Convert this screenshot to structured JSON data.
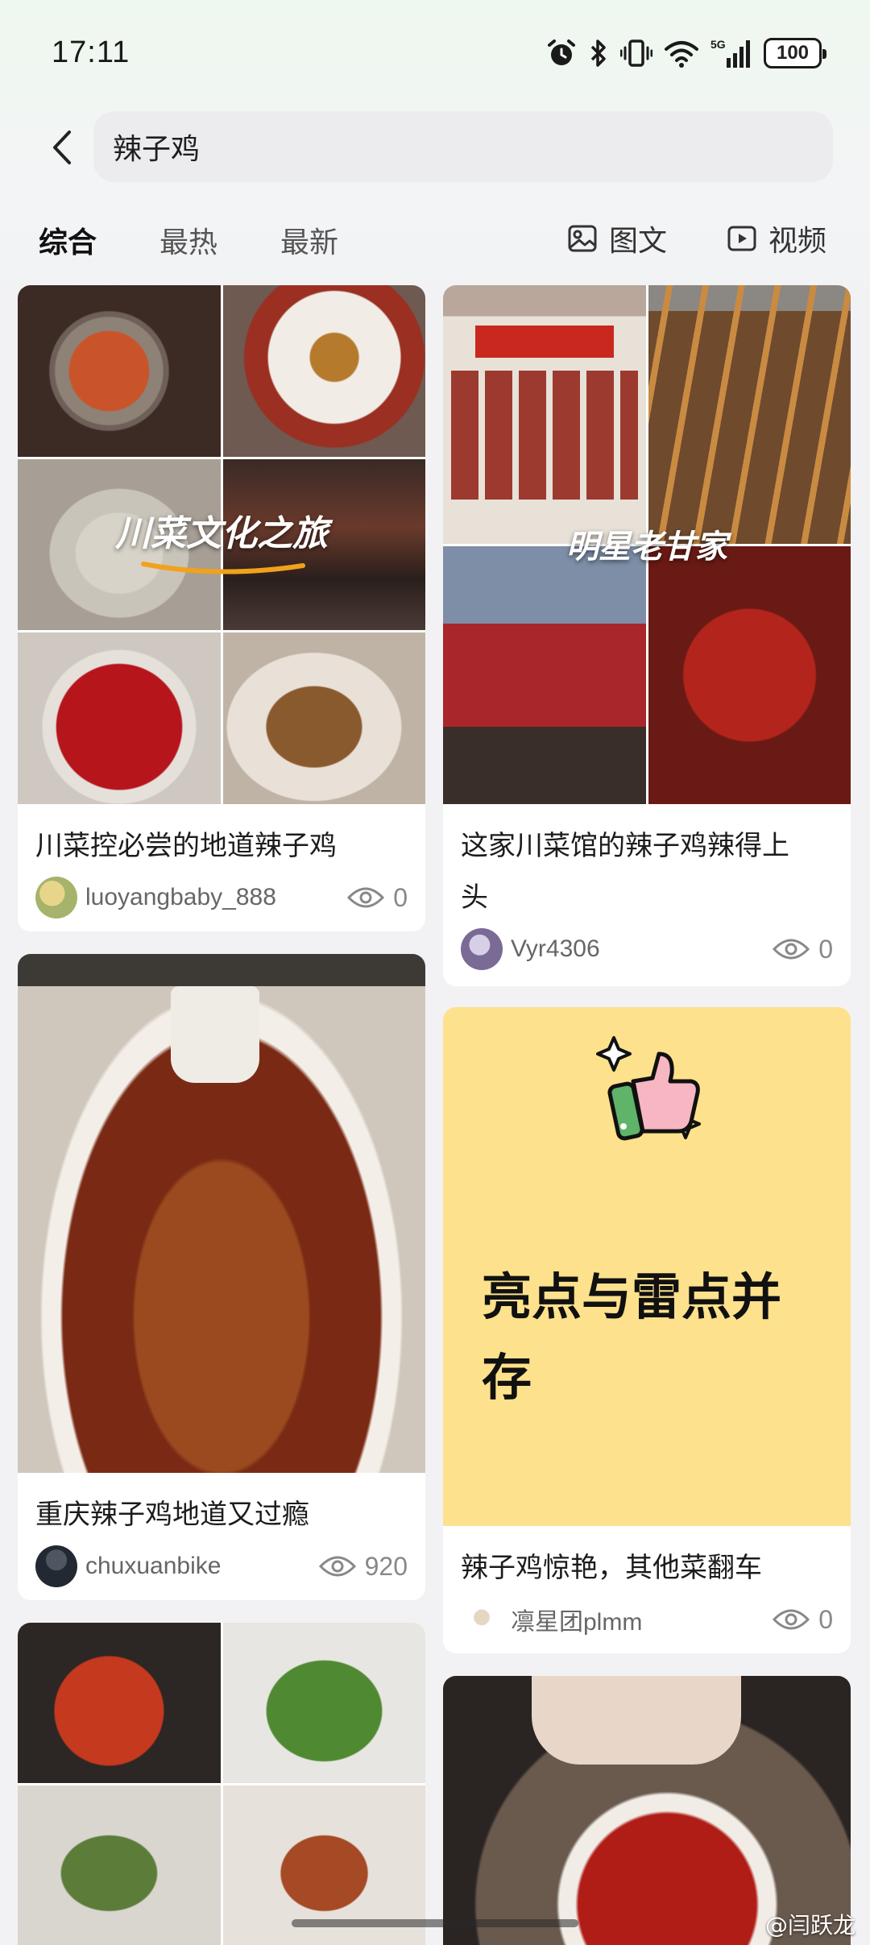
{
  "status_bar": {
    "time": "17:11",
    "battery": "100",
    "network": "5G",
    "icons": [
      "alarm-icon",
      "bluetooth-icon",
      "vibrate-icon",
      "wifi-icon",
      "signal-icon",
      "battery-icon"
    ]
  },
  "search": {
    "query": "辣子鸡"
  },
  "tabs": {
    "sort": [
      "综合",
      "最热",
      "最新"
    ],
    "active_index": 0,
    "image_text_label": "图文",
    "video_label": "视频"
  },
  "feed": {
    "left": [
      {
        "image_overlay": "川菜文化之旅",
        "title": "川菜控必尝的地道辣子鸡",
        "author": "luoyangbaby_888",
        "views": "0"
      },
      {
        "title": "重庆辣子鸡地道又过瘾",
        "author": "chuxuanbike",
        "views": "920"
      },
      {}
    ],
    "right": [
      {
        "image_overlay": "明星老甘家",
        "title_line1": "这家川菜馆的辣子鸡辣得上",
        "title_line2": "头",
        "author": "Vyr4306",
        "views": "0"
      },
      {
        "poster_line1": "亮点与雷点并",
        "poster_line2": "存",
        "title": "辣子鸡惊艳，其他菜翻车",
        "author": "凛星团plmm",
        "views": "0"
      },
      {}
    ]
  },
  "watermark": "@闫跃龙",
  "colors": {
    "poster_bg": "#fde18c",
    "search_bg": "#ececef",
    "page_bg": "#f2f2f4"
  }
}
